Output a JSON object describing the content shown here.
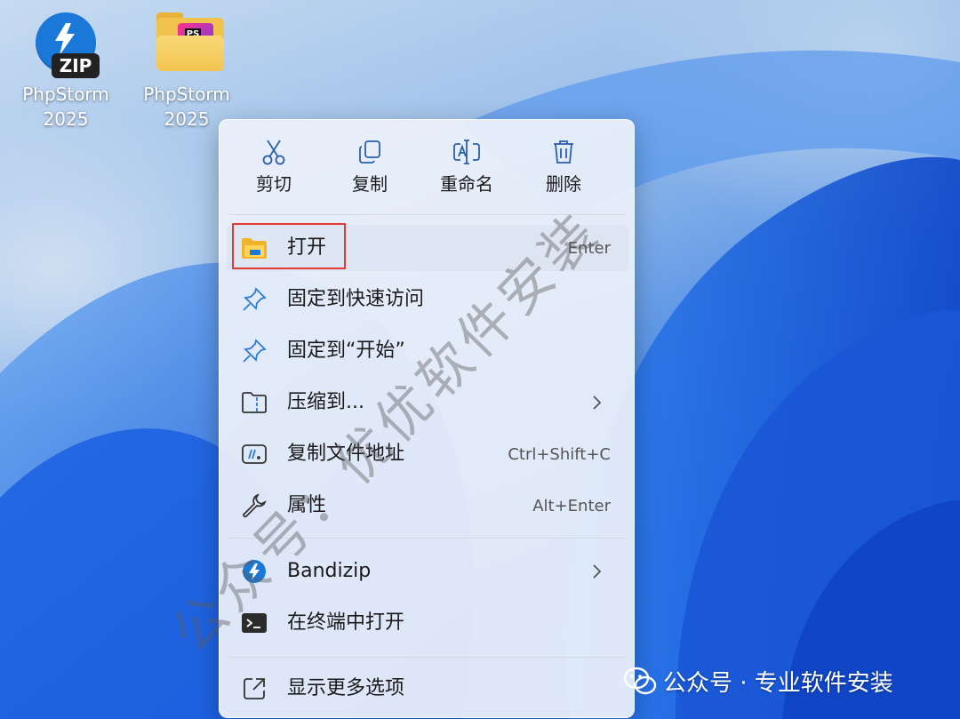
{
  "desktop": {
    "icons": [
      {
        "label_line1": "PhpStorm",
        "label_line2": "2025",
        "badge": "ZIP",
        "icon": "bandizip-archive-icon"
      },
      {
        "label_line1": "PhpStorm",
        "label_line2": "2025",
        "badge": "PS",
        "icon": "folder-icon"
      }
    ]
  },
  "context_menu": {
    "quick_actions": [
      {
        "label": "剪切",
        "icon": "scissors-icon"
      },
      {
        "label": "复制",
        "icon": "copy-icon"
      },
      {
        "label": "重命名",
        "icon": "rename-icon"
      },
      {
        "label": "删除",
        "icon": "trash-icon"
      }
    ],
    "items": [
      {
        "label": "打开",
        "shortcut": "Enter",
        "icon": "folder-open-icon"
      },
      {
        "label": "固定到快速访问",
        "shortcut": "",
        "icon": "pin-icon"
      },
      {
        "label": "固定到“开始”",
        "shortcut": "",
        "icon": "pin-icon"
      },
      {
        "label": "压缩到...",
        "shortcut": "",
        "icon": "compress-icon",
        "submenu": true
      },
      {
        "label": "复制文件地址",
        "shortcut": "Ctrl+Shift+C",
        "icon": "copy-path-icon"
      },
      {
        "label": "属性",
        "shortcut": "Alt+Enter",
        "icon": "wrench-icon"
      },
      {
        "label": "Bandizip",
        "shortcut": "",
        "icon": "bandizip-icon",
        "submenu": true
      },
      {
        "label": "在终端中打开",
        "shortcut": "",
        "icon": "terminal-icon"
      },
      {
        "label": "显示更多选项",
        "shortcut": "",
        "icon": "more-options-icon"
      }
    ]
  },
  "watermark": {
    "diagonal_text": "公众号：优优软件安装",
    "footer_text": "公众号 · 专业软件安装"
  },
  "colors": {
    "accent_blue": "#1a78d8",
    "highlight_red": "#e53935"
  }
}
